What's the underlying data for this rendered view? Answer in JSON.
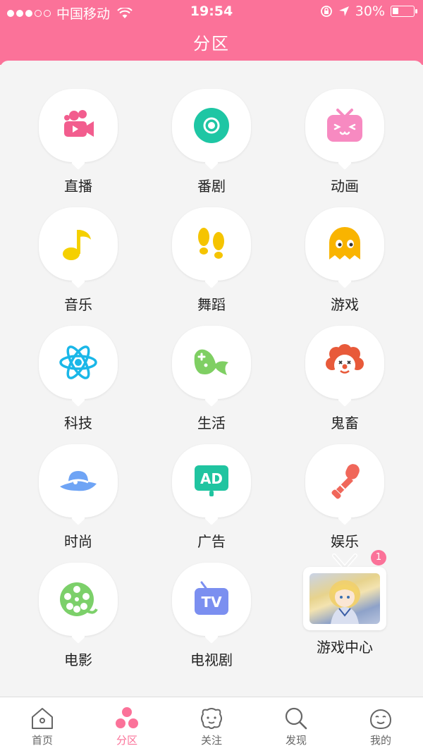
{
  "status_bar": {
    "carrier": "中国移动",
    "time": "19:54",
    "battery_percent": "30%",
    "battery_level": 0.3
  },
  "header": {
    "title": "分区"
  },
  "categories": [
    {
      "label": "直播",
      "icon": "video-camera-icon",
      "color": "#f25d8e"
    },
    {
      "label": "番剧",
      "icon": "disc-icon",
      "color": "#1ec6a4"
    },
    {
      "label": "动画",
      "icon": "tv-face-icon",
      "color": "#f78ac1"
    },
    {
      "label": "音乐",
      "icon": "music-note-icon",
      "color": "#f5d000"
    },
    {
      "label": "舞蹈",
      "icon": "footprints-icon",
      "color": "#f5c400"
    },
    {
      "label": "游戏",
      "icon": "ghost-icon",
      "color": "#f9b400"
    },
    {
      "label": "科技",
      "icon": "atom-icon",
      "color": "#1ab7e8"
    },
    {
      "label": "生活",
      "icon": "fish-icon",
      "color": "#7fcf63"
    },
    {
      "label": "鬼畜",
      "icon": "clown-icon",
      "color": "#e85a3a"
    },
    {
      "label": "时尚",
      "icon": "hat-icon",
      "color": "#6fa4f5"
    },
    {
      "label": "广告",
      "icon": "ad-icon",
      "color": "#20c4a0"
    },
    {
      "label": "娱乐",
      "icon": "microphone-icon",
      "color": "#f0675a"
    },
    {
      "label": "电影",
      "icon": "film-reel-icon",
      "color": "#7cd06a"
    },
    {
      "label": "电视剧",
      "icon": "tv-icon",
      "color": "#7b8ff0"
    }
  ],
  "game_center": {
    "label": "游戏中心",
    "badge": "1"
  },
  "tabbar": {
    "items": [
      {
        "label": "首页",
        "icon": "home-icon"
      },
      {
        "label": "分区",
        "icon": "category-dots-icon"
      },
      {
        "label": "关注",
        "icon": "follow-icon"
      },
      {
        "label": "发现",
        "icon": "search-icon"
      },
      {
        "label": "我的",
        "icon": "profile-face-icon"
      }
    ],
    "active_index": 1
  },
  "colors": {
    "brand": "#fb7299",
    "background": "#f4f4f4"
  }
}
